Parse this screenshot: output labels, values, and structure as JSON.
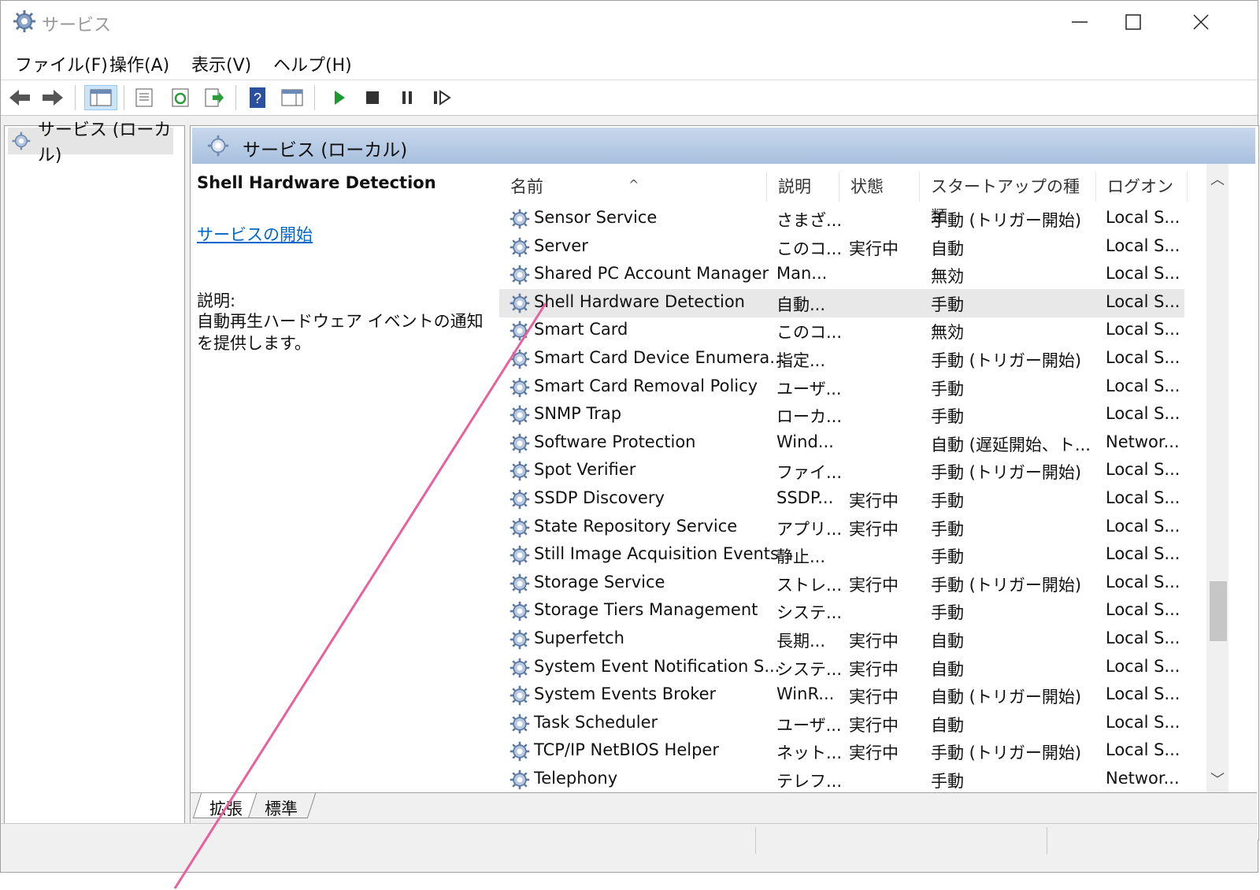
{
  "window": {
    "title": "サービス"
  },
  "menu": [
    "ファイル(F)",
    "操作(A)",
    "表示(V)",
    "ヘルプ(H)"
  ],
  "toolbar": [
    "back-arrow-icon",
    "forward-arrow-icon",
    "console-tree-icon",
    "properties-icon",
    "refresh-icon",
    "export-icon",
    "help-icon",
    "view-icon",
    "start-icon",
    "stop-icon",
    "pause-icon",
    "resume-icon"
  ],
  "tree": {
    "item": "サービス (ローカル)"
  },
  "pane": {
    "header": "サービス (ローカル)",
    "detail_title": "Shell Hardware Detection",
    "detail_link": "サービスの開始",
    "desc_label": "説明:",
    "desc_text": "自動再生ハードウェア イベントの通知を提供します。"
  },
  "columns": {
    "name": "名前",
    "desc": "説明",
    "status": "状態",
    "startup": "スタートアップの種類",
    "logon": "ログオン"
  },
  "rows": [
    {
      "name": "Sensor Service",
      "desc": "さまざ...",
      "status": "",
      "startup": "手動 (トリガー開始)",
      "logon": "Local S..."
    },
    {
      "name": "Server",
      "desc": "このコ...",
      "status": "実行中",
      "startup": "自動",
      "logon": "Local S..."
    },
    {
      "name": "Shared PC Account Manager",
      "desc": "Man...",
      "status": "",
      "startup": "無効",
      "logon": "Local S..."
    },
    {
      "name": "Shell Hardware Detection",
      "desc": "自動...",
      "status": "",
      "startup": "手動",
      "logon": "Local S...",
      "selected": true
    },
    {
      "name": "Smart Card",
      "desc": "このコ...",
      "status": "",
      "startup": "無効",
      "logon": "Local S..."
    },
    {
      "name": "Smart Card Device Enumera...",
      "desc": "指定...",
      "status": "",
      "startup": "手動 (トリガー開始)",
      "logon": "Local S..."
    },
    {
      "name": "Smart Card Removal Policy",
      "desc": "ユーザ...",
      "status": "",
      "startup": "手動",
      "logon": "Local S..."
    },
    {
      "name": "SNMP Trap",
      "desc": "ローカ...",
      "status": "",
      "startup": "手動",
      "logon": "Local S..."
    },
    {
      "name": "Software Protection",
      "desc": "Wind...",
      "status": "",
      "startup": "自動 (遅延開始、ト...",
      "logon": "Networ..."
    },
    {
      "name": "Spot Verifier",
      "desc": "ファイ...",
      "status": "",
      "startup": "手動 (トリガー開始)",
      "logon": "Local S..."
    },
    {
      "name": "SSDP Discovery",
      "desc": "SSDP...",
      "status": "実行中",
      "startup": "手動",
      "logon": "Local S..."
    },
    {
      "name": "State Repository Service",
      "desc": "アプリ...",
      "status": "実行中",
      "startup": "手動",
      "logon": "Local S..."
    },
    {
      "name": "Still Image Acquisition Events",
      "desc": "静止...",
      "status": "",
      "startup": "手動",
      "logon": "Local S..."
    },
    {
      "name": "Storage Service",
      "desc": "ストレ...",
      "status": "実行中",
      "startup": "手動 (トリガー開始)",
      "logon": "Local S..."
    },
    {
      "name": "Storage Tiers Management",
      "desc": "システ...",
      "status": "",
      "startup": "手動",
      "logon": "Local S..."
    },
    {
      "name": "Superfetch",
      "desc": "長期...",
      "status": "実行中",
      "startup": "自動",
      "logon": "Local S..."
    },
    {
      "name": "System Event Notification S...",
      "desc": "システ...",
      "status": "実行中",
      "startup": "自動",
      "logon": "Local S..."
    },
    {
      "name": "System Events Broker",
      "desc": "WinR...",
      "status": "実行中",
      "startup": "自動 (トリガー開始)",
      "logon": "Local S..."
    },
    {
      "name": "Task Scheduler",
      "desc": "ユーザ...",
      "status": "実行中",
      "startup": "自動",
      "logon": "Local S..."
    },
    {
      "name": "TCP/IP NetBIOS Helper",
      "desc": "ネット...",
      "status": "実行中",
      "startup": "手動 (トリガー開始)",
      "logon": "Local S..."
    },
    {
      "name": "Telephony",
      "desc": "テレフ...",
      "status": "",
      "startup": "手動",
      "logon": "Networ..."
    }
  ],
  "tabs": [
    "拡張",
    "標準"
  ],
  "colors": {
    "accent_link": "#0066cc",
    "header_blue": "#a8c0de",
    "annotation": "#e8619c"
  }
}
